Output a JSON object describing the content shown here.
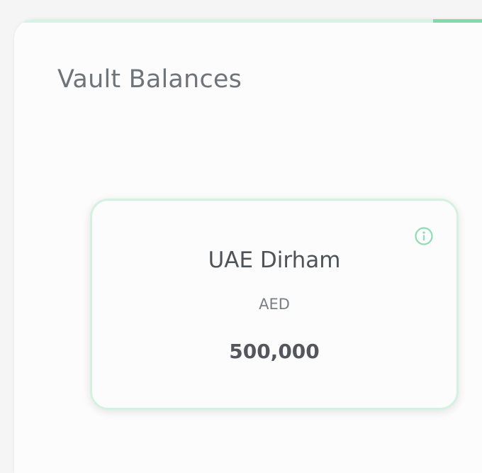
{
  "panel": {
    "title": "Vault Balances"
  },
  "vault_card": {
    "currency_name": "UAE Dirham",
    "currency_code": "AED",
    "balance": "500,000",
    "info_icon": "info-icon"
  },
  "colors": {
    "accent": "#7fdcaa",
    "accent_light": "#d3f2e2",
    "title_text": "#6f747a",
    "body_text": "#4e5359"
  }
}
